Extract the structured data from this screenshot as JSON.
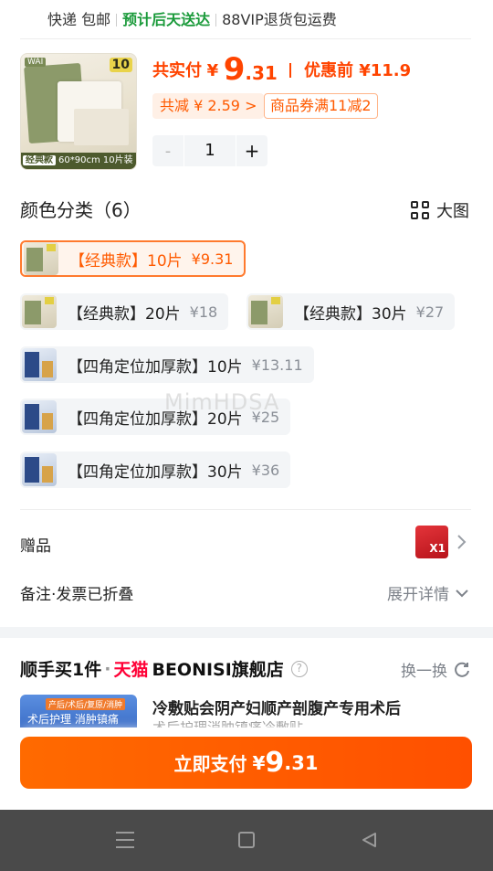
{
  "delivery": {
    "shipping": "快递 包邮",
    "eta": "预计后天送达",
    "vip": "88VIP退货包运费"
  },
  "product": {
    "thumb_brand": "WAI",
    "thumb_count": "10",
    "thumb_caption_tag": "经典款",
    "thumb_caption": "60*90cm 10片装",
    "pay_label": "共实付",
    "currency": "¥",
    "price_int": "9",
    "price_dec": ".31",
    "before_discount": "优惠前 ¥11.9",
    "total_reduce": "共减 ¥ 2.59 >",
    "coupon": "商品券满11减2",
    "stepper": {
      "minus": "-",
      "qty": "1",
      "plus": "+"
    }
  },
  "colors": {
    "title": "颜色分类（6）",
    "big_view": "大图",
    "options": [
      {
        "name": "【经典款】10片",
        "price": "¥9.31",
        "selected": true
      },
      {
        "name": "【经典款】20片",
        "price": "¥18"
      },
      {
        "name": "【经典款】30片",
        "price": "¥27"
      },
      {
        "name": "【四角定位加厚款】10片",
        "price": "¥13.11"
      },
      {
        "name": "【四角定位加厚款】20片",
        "price": "¥25"
      },
      {
        "name": "【四角定位加厚款】30片",
        "price": "¥36"
      }
    ]
  },
  "gift": {
    "label": "赠品",
    "badge": "X1"
  },
  "note": {
    "label": "备注·发票已折叠",
    "expand": "展开详情"
  },
  "recommend": {
    "title": "顺手买1件",
    "dot": "·",
    "platform": "天猫",
    "shop": "BEONISI旗舰店",
    "help": "?",
    "swap": "换一换",
    "img_tag": "产后/术后/复原/消肿",
    "img_text": "术后护理 消肿镇痛",
    "name": "冷敷贴会阴产妇顺产剖腹产专用术后",
    "sub": "术后护理消肿镇痛冷敷贴"
  },
  "pay": {
    "label": "立即支付",
    "currency": "¥",
    "int": "9",
    "dec": ".31"
  },
  "watermark": "MimHDSA",
  "icons": {
    "grid": "grid-icon",
    "chevron_right": "chevron-right-icon",
    "chevron_down": "chevron-down-icon",
    "refresh": "refresh-icon",
    "question": "question-icon",
    "nav_menu": "menu-icon",
    "nav_home": "home-icon",
    "nav_back": "back-icon"
  },
  "colors_theme": {
    "accent": "#ff5000",
    "green": "#1a9a3a",
    "tmall": "#ff0036"
  }
}
